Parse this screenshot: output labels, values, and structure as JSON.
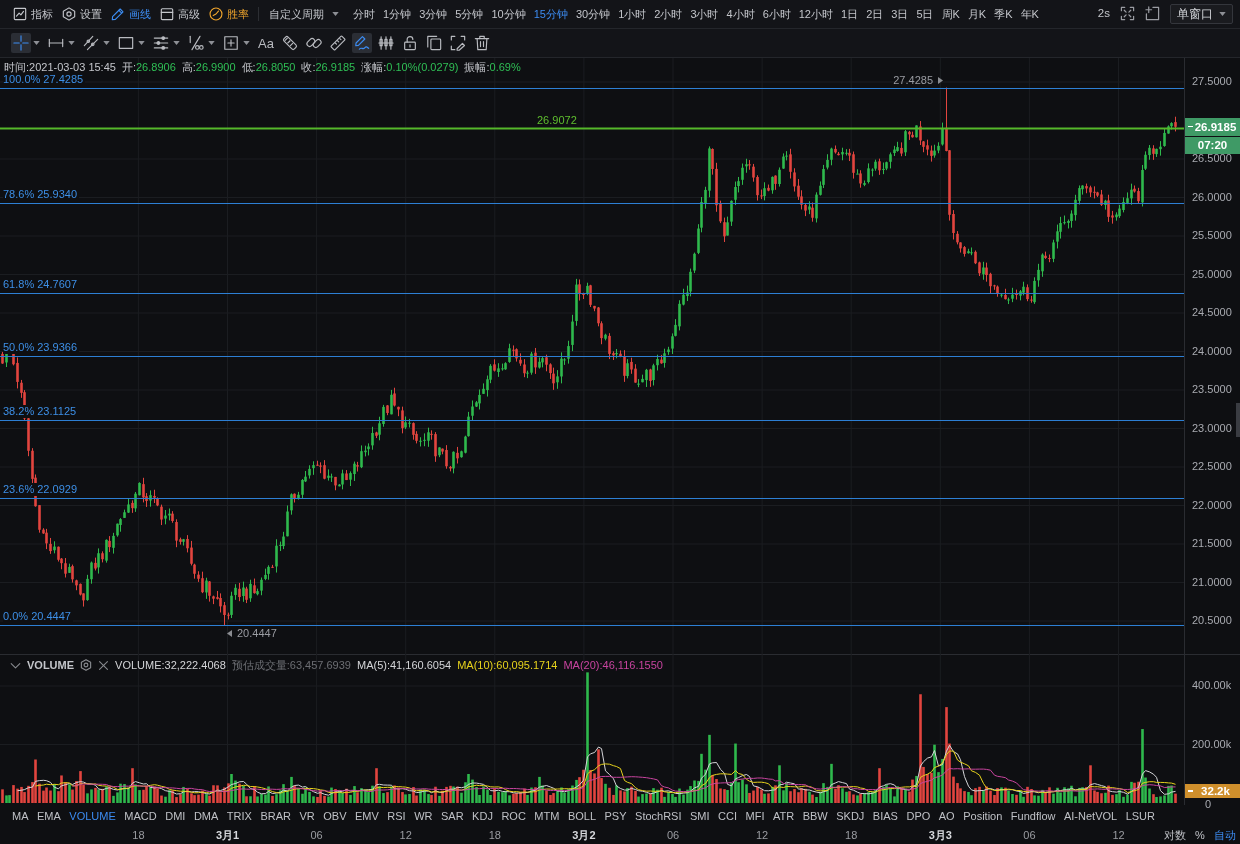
{
  "top_bar": {
    "menu": [
      {
        "kind": "indicators",
        "label": "指标",
        "selected": false,
        "highlighted": false
      },
      {
        "kind": "settings",
        "label": "设置",
        "selected": false,
        "highlighted": false
      },
      {
        "kind": "drawing",
        "label": "画线",
        "selected": true,
        "highlighted": false
      },
      {
        "kind": "advanced",
        "label": "高级",
        "selected": false,
        "highlighted": false
      },
      {
        "kind": "winrate",
        "label": "胜率",
        "selected": false,
        "highlighted": true
      }
    ],
    "period_picker": "自定义周期",
    "periods": [
      {
        "label": "分时",
        "selected": false
      },
      {
        "label": "1分钟",
        "selected": false
      },
      {
        "label": "3分钟",
        "selected": false
      },
      {
        "label": "5分钟",
        "selected": false
      },
      {
        "label": "10分钟",
        "selected": false
      },
      {
        "label": "15分钟",
        "selected": true
      },
      {
        "label": "30分钟",
        "selected": false
      },
      {
        "label": "1小时",
        "selected": false
      },
      {
        "label": "2小时",
        "selected": false
      },
      {
        "label": "3小时",
        "selected": false
      },
      {
        "label": "4小时",
        "selected": false
      },
      {
        "label": "6小时",
        "selected": false
      },
      {
        "label": "12小时",
        "selected": false
      },
      {
        "label": "1日",
        "selected": false
      },
      {
        "label": "2日",
        "selected": false
      },
      {
        "label": "3日",
        "selected": false
      },
      {
        "label": "5日",
        "selected": false
      },
      {
        "label": "周K",
        "selected": false
      },
      {
        "label": "月K",
        "selected": false
      },
      {
        "label": "季K",
        "selected": false
      },
      {
        "label": "年K",
        "selected": false
      }
    ],
    "refresh_interval": "2s",
    "window_mode": "单窗口"
  },
  "drawing_tools": [
    {
      "kind": "crosshair",
      "has_menu": true,
      "selected": true
    },
    {
      "kind": "segment",
      "has_menu": true,
      "selected": false
    },
    {
      "kind": "trendline",
      "has_menu": true,
      "selected": false
    },
    {
      "kind": "rectangle",
      "has_menu": true,
      "selected": false
    },
    {
      "kind": "parallel",
      "has_menu": true,
      "selected": false
    },
    {
      "kind": "fibonacci",
      "has_menu": true,
      "selected": false
    },
    {
      "kind": "annotation",
      "has_menu": true,
      "selected": false
    },
    {
      "kind": "text",
      "label": "Aa",
      "has_menu": false,
      "selected": false
    },
    {
      "kind": "pattern",
      "has_menu": false,
      "selected": false
    },
    {
      "kind": "link",
      "has_menu": false,
      "selected": false
    },
    {
      "kind": "ruler",
      "has_menu": false,
      "selected": false
    },
    {
      "kind": "brush",
      "has_menu": false,
      "selected": true
    },
    {
      "kind": "bars",
      "has_menu": false,
      "selected": false
    },
    {
      "kind": "lock",
      "has_menu": false,
      "selected": false
    },
    {
      "kind": "copy",
      "has_menu": false,
      "selected": false
    },
    {
      "kind": "capture",
      "has_menu": false,
      "selected": false
    },
    {
      "kind": "delete",
      "has_menu": false,
      "selected": false
    }
  ],
  "main_chart": {
    "ohlc": {
      "time": "时间:2021-03-03 15:45",
      "fields": [
        {
          "label": "开:",
          "value": "26.8906",
          "rising": true
        },
        {
          "label": "高:",
          "value": "26.9900",
          "rising": true
        },
        {
          "label": "低:",
          "value": "26.8050",
          "rising": true
        },
        {
          "label": "收:",
          "value": "26.9185",
          "rising": true
        },
        {
          "label": "涨幅:",
          "value": "0.10%(0.0279)",
          "rising": true
        },
        {
          "label": "振幅:",
          "value": "0.69%",
          "rising": true
        }
      ]
    },
    "fibonacci_levels": [
      "100.0% 27.4285",
      "78.6% 25.9340",
      "61.8% 24.7607",
      "50.0% 23.9366",
      "38.2% 23.1125",
      "23.6% 22.0929",
      "0.0% 20.4447"
    ],
    "price_line_label": "26.9072",
    "high_marker": "27.4285",
    "low_marker": "20.4447",
    "y_axis": {
      "ticks": [
        "27.5000",
        "26.5000",
        "26.0000",
        "25.5000",
        "25.0000",
        "24.5000",
        "24.0000",
        "23.5000",
        "23.0000",
        "22.5000",
        "22.0000",
        "21.5000",
        "21.0000",
        "20.5000"
      ],
      "last_price": "26.9185",
      "countdown": "07:20"
    }
  },
  "volume_pane": {
    "title": "VOLUME",
    "readouts": [
      {
        "kind": "value",
        "text": "VOLUME:32,222.4068",
        "color": "#d4d5d8"
      },
      {
        "kind": "estimate",
        "text": "预估成交量:63,457.6939",
        "color": "#6c6e73"
      },
      {
        "kind": "ma",
        "text": "MA(5):41,160.6054",
        "color": "#d4d5d8"
      },
      {
        "kind": "ma",
        "text": "MA(10):60,095.1714",
        "color": "#e6d21c"
      },
      {
        "kind": "ma",
        "text": "MA(20):46,116.1550",
        "color": "#c8449f"
      }
    ],
    "y_axis": {
      "ticks": [
        "400.00k",
        "200.00k",
        "0"
      ],
      "last_value": "32.2k"
    }
  },
  "indicator_tabs": [
    {
      "label": "MA",
      "selected": false
    },
    {
      "label": "EMA",
      "selected": false
    },
    {
      "label": "VOLUME",
      "selected": true
    },
    {
      "label": "MACD",
      "selected": false
    },
    {
      "label": "DMI",
      "selected": false
    },
    {
      "label": "DMA",
      "selected": false
    },
    {
      "label": "TRIX",
      "selected": false
    },
    {
      "label": "BRAR",
      "selected": false
    },
    {
      "label": "VR",
      "selected": false
    },
    {
      "label": "OBV",
      "selected": false
    },
    {
      "label": "EMV",
      "selected": false
    },
    {
      "label": "RSI",
      "selected": false
    },
    {
      "label": "WR",
      "selected": false
    },
    {
      "label": "SAR",
      "selected": false
    },
    {
      "label": "KDJ",
      "selected": false
    },
    {
      "label": "ROC",
      "selected": false
    },
    {
      "label": "MTM",
      "selected": false
    },
    {
      "label": "BOLL",
      "selected": false
    },
    {
      "label": "PSY",
      "selected": false
    },
    {
      "label": "StochRSI",
      "selected": false
    },
    {
      "label": "SMI",
      "selected": false
    },
    {
      "label": "CCI",
      "selected": false
    },
    {
      "label": "MFI",
      "selected": false
    },
    {
      "label": "ATR",
      "selected": false
    },
    {
      "label": "BBW",
      "selected": false
    },
    {
      "label": "SKDJ",
      "selected": false
    },
    {
      "label": "BIAS",
      "selected": false
    },
    {
      "label": "DPO",
      "selected": false
    },
    {
      "label": "AO",
      "selected": false
    },
    {
      "label": "Position",
      "selected": false
    },
    {
      "label": "Fundflow",
      "selected": false
    },
    {
      "label": "AI-NetVOL",
      "selected": false
    },
    {
      "label": "LSUR",
      "selected": false
    }
  ],
  "time_axis": [
    {
      "label": "18",
      "major": false
    },
    {
      "label": "3月1",
      "major": true
    },
    {
      "label": "06",
      "major": false
    },
    {
      "label": "12",
      "major": false
    },
    {
      "label": "18",
      "major": false
    },
    {
      "label": "3月2",
      "major": true
    },
    {
      "label": "06",
      "major": false
    },
    {
      "label": "12",
      "major": false
    },
    {
      "label": "18",
      "major": false
    },
    {
      "label": "3月3",
      "major": true
    },
    {
      "label": "06",
      "major": false
    },
    {
      "label": "12",
      "major": false
    }
  ],
  "scale_options": [
    {
      "label": "对数",
      "on": false
    },
    {
      "label": "%",
      "on": false
    },
    {
      "label": "自动",
      "on": true
    }
  ]
}
